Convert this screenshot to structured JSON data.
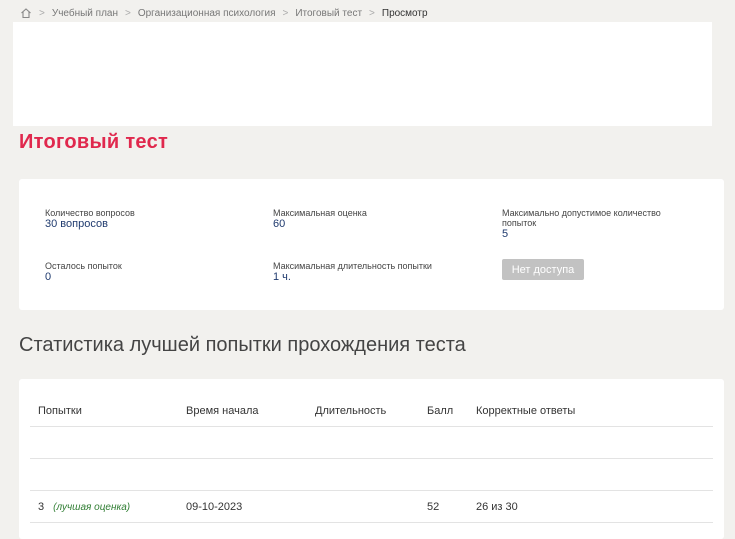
{
  "breadcrumb": {
    "items": [
      "Учебный план",
      "Организационная психология",
      "Итоговый тест",
      "Просмотр"
    ]
  },
  "page": {
    "title": "Итоговый тест"
  },
  "info": {
    "questions_label": "Количество вопросов",
    "questions_value": "30 вопросов",
    "max_score_label": "Максимальная оценка",
    "max_score_value": "60",
    "max_attempts_label": "Максимально допустимое количество попыток",
    "max_attempts_value": "5",
    "remaining_label": "Осталось попыток",
    "remaining_value": "0",
    "max_duration_label": "Максимальная длительность попытки",
    "max_duration_value": "1 ч.",
    "access_button": "Нет доступа"
  },
  "stats": {
    "title": "Статистика лучшей попытки прохождения теста",
    "columns": [
      "Попытки",
      "Время начала",
      "Длительность",
      "Балл",
      "Корректные ответы"
    ],
    "rows": [
      {
        "attempt": "",
        "best_label": "",
        "start": "",
        "duration": "",
        "score": "",
        "correct": ""
      },
      {
        "attempt": "",
        "best_label": "",
        "start": "",
        "duration": "",
        "score": "",
        "correct": ""
      },
      {
        "attempt": "3",
        "best_label": "(лучшая оценка)",
        "start": "09-10-2023",
        "duration": "",
        "score": "52",
        "correct": "26 из 30"
      }
    ]
  }
}
